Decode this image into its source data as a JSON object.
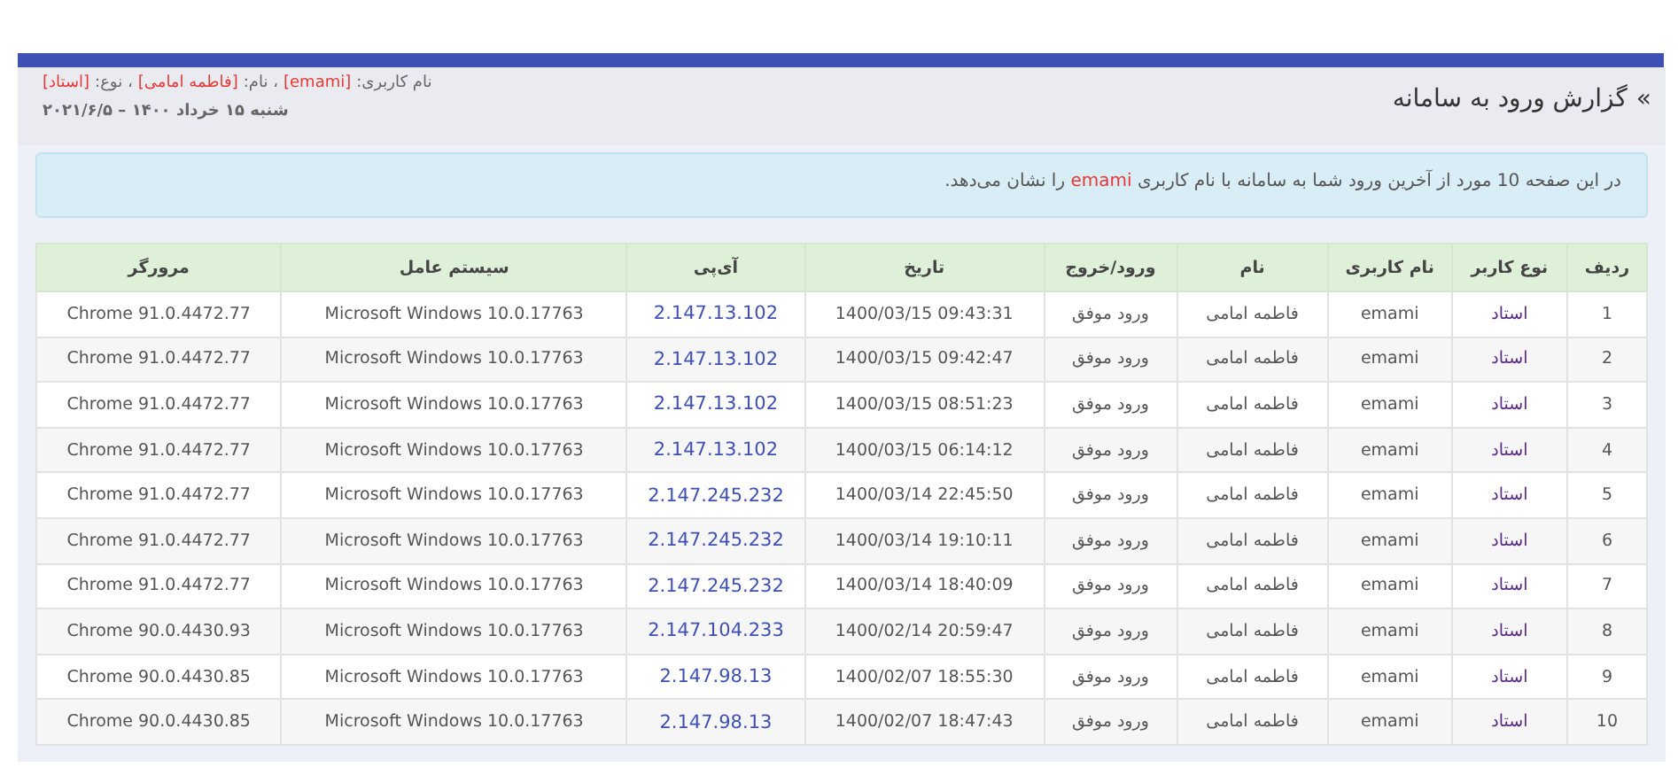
{
  "page": {
    "title": "گزارش ورود به سامانه",
    "title_icon": "»",
    "user_info": [
      {
        "label": "نام کاربری:",
        "value": "[emami]"
      },
      {
        "label": "، نام:",
        "value": "[فاطمه امامی]"
      },
      {
        "label": "، نوع:",
        "value": "[استاد]"
      }
    ],
    "date": "شنبه ۱۵ خرداد ۱۴۰۰ – ۲۰۲۱/۶/۵"
  },
  "alert": {
    "before": "در این صفحه 10 مورد از آخرین ورود شما به سامانه با نام کاربری",
    "highlight": "emami",
    "after": "را نشان می‌دهد."
  },
  "table": {
    "columns": [
      "ردیف",
      "نوع کاربر",
      "نام کاربری",
      "نام",
      "ورود/خروج",
      "تاریخ",
      "آی‌پی",
      "سیستم عامل",
      "مرورگر"
    ],
    "rows": [
      [
        "1",
        "استاد",
        "emami",
        "فاطمه امامی",
        "ورود موفق",
        "1400/03/15 09:43:31",
        "2.147.13.102",
        "Microsoft Windows 10.0.17763",
        "Chrome 91.0.4472.77"
      ],
      [
        "2",
        "استاد",
        "emami",
        "فاطمه امامی",
        "ورود موفق",
        "1400/03/15 09:42:47",
        "2.147.13.102",
        "Microsoft Windows 10.0.17763",
        "Chrome 91.0.4472.77"
      ],
      [
        "3",
        "استاد",
        "emami",
        "فاطمه امامی",
        "ورود موفق",
        "1400/03/15 08:51:23",
        "2.147.13.102",
        "Microsoft Windows 10.0.17763",
        "Chrome 91.0.4472.77"
      ],
      [
        "4",
        "استاد",
        "emami",
        "فاطمه امامی",
        "ورود موفق",
        "1400/03/15 06:14:12",
        "2.147.13.102",
        "Microsoft Windows 10.0.17763",
        "Chrome 91.0.4472.77"
      ],
      [
        "5",
        "استاد",
        "emami",
        "فاطمه امامی",
        "ورود موفق",
        "1400/03/14 22:45:50",
        "2.147.245.232",
        "Microsoft Windows 10.0.17763",
        "Chrome 91.0.4472.77"
      ],
      [
        "6",
        "استاد",
        "emami",
        "فاطمه امامی",
        "ورود موفق",
        "1400/03/14 19:10:11",
        "2.147.245.232",
        "Microsoft Windows 10.0.17763",
        "Chrome 91.0.4472.77"
      ],
      [
        "7",
        "استاد",
        "emami",
        "فاطمه امامی",
        "ورود موفق",
        "1400/03/14 18:40:09",
        "2.147.245.232",
        "Microsoft Windows 10.0.17763",
        "Chrome 91.0.4472.77"
      ],
      [
        "8",
        "استاد",
        "emami",
        "فاطمه امامی",
        "ورود موفق",
        "1400/02/14 20:59:47",
        "2.147.104.233",
        "Microsoft Windows 10.0.17763",
        "Chrome 90.0.4430.93"
      ],
      [
        "9",
        "استاد",
        "emami",
        "فاطمه امامی",
        "ورود موفق",
        "1400/02/07 18:55:30",
        "2.147.98.13",
        "Microsoft Windows 10.0.17763",
        "Chrome 90.0.4430.85"
      ],
      [
        "10",
        "استاد",
        "emami",
        "فاطمه امامی",
        "ورود موفق",
        "1400/02/07 18:47:43",
        "2.147.98.13",
        "Microsoft Windows 10.0.17763",
        "Chrome 90.0.4430.85"
      ]
    ]
  }
}
